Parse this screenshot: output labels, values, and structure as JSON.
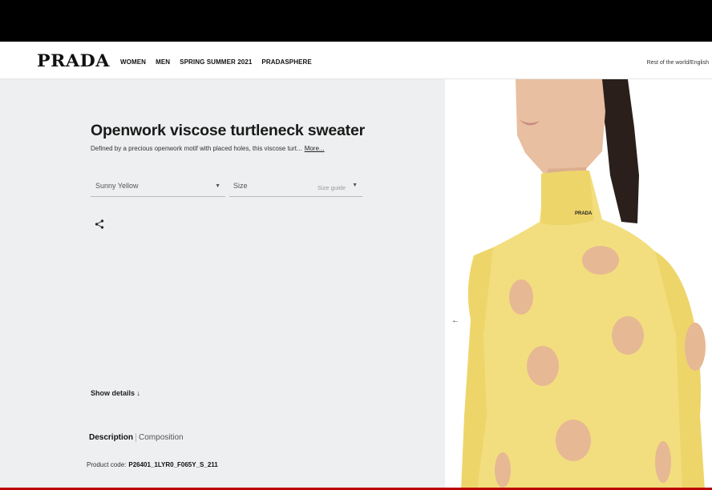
{
  "brand": {
    "logo": "PRADA"
  },
  "nav": {
    "items": [
      {
        "label": "WOMEN"
      },
      {
        "label": "MEN"
      },
      {
        "label": "SPRING SUMMER 2021"
      },
      {
        "label": "PRADASPHERE"
      }
    ],
    "region": "Rest of the world/English"
  },
  "product": {
    "title": "Openwork viscose turtleneck sweater",
    "description": "Defined by a precious openwork motif with placed holes, this viscose turt...",
    "more_label": "More...",
    "color_select": {
      "value": "Sunny Yellow",
      "icon": "chevron-down-icon"
    },
    "size_select": {
      "label": "Size",
      "size_guide": "Size guide",
      "icon": "chevron-down-icon"
    },
    "share_icon": "share-icon",
    "show_details": "Show details ↓",
    "tabs": [
      {
        "label": "Description",
        "active": true
      },
      {
        "label": "Composition",
        "active": false
      }
    ],
    "code_label": "Product code:",
    "code_value": "P26401_1LYR0_F065Y_S_211"
  },
  "gallery": {
    "prev_icon": "arrow-left-icon",
    "neck_logo": "PRADA"
  },
  "colors": {
    "sweater": "#f2de7e",
    "panel_bg": "#eeeff0",
    "skin": "#e8bfa0"
  }
}
